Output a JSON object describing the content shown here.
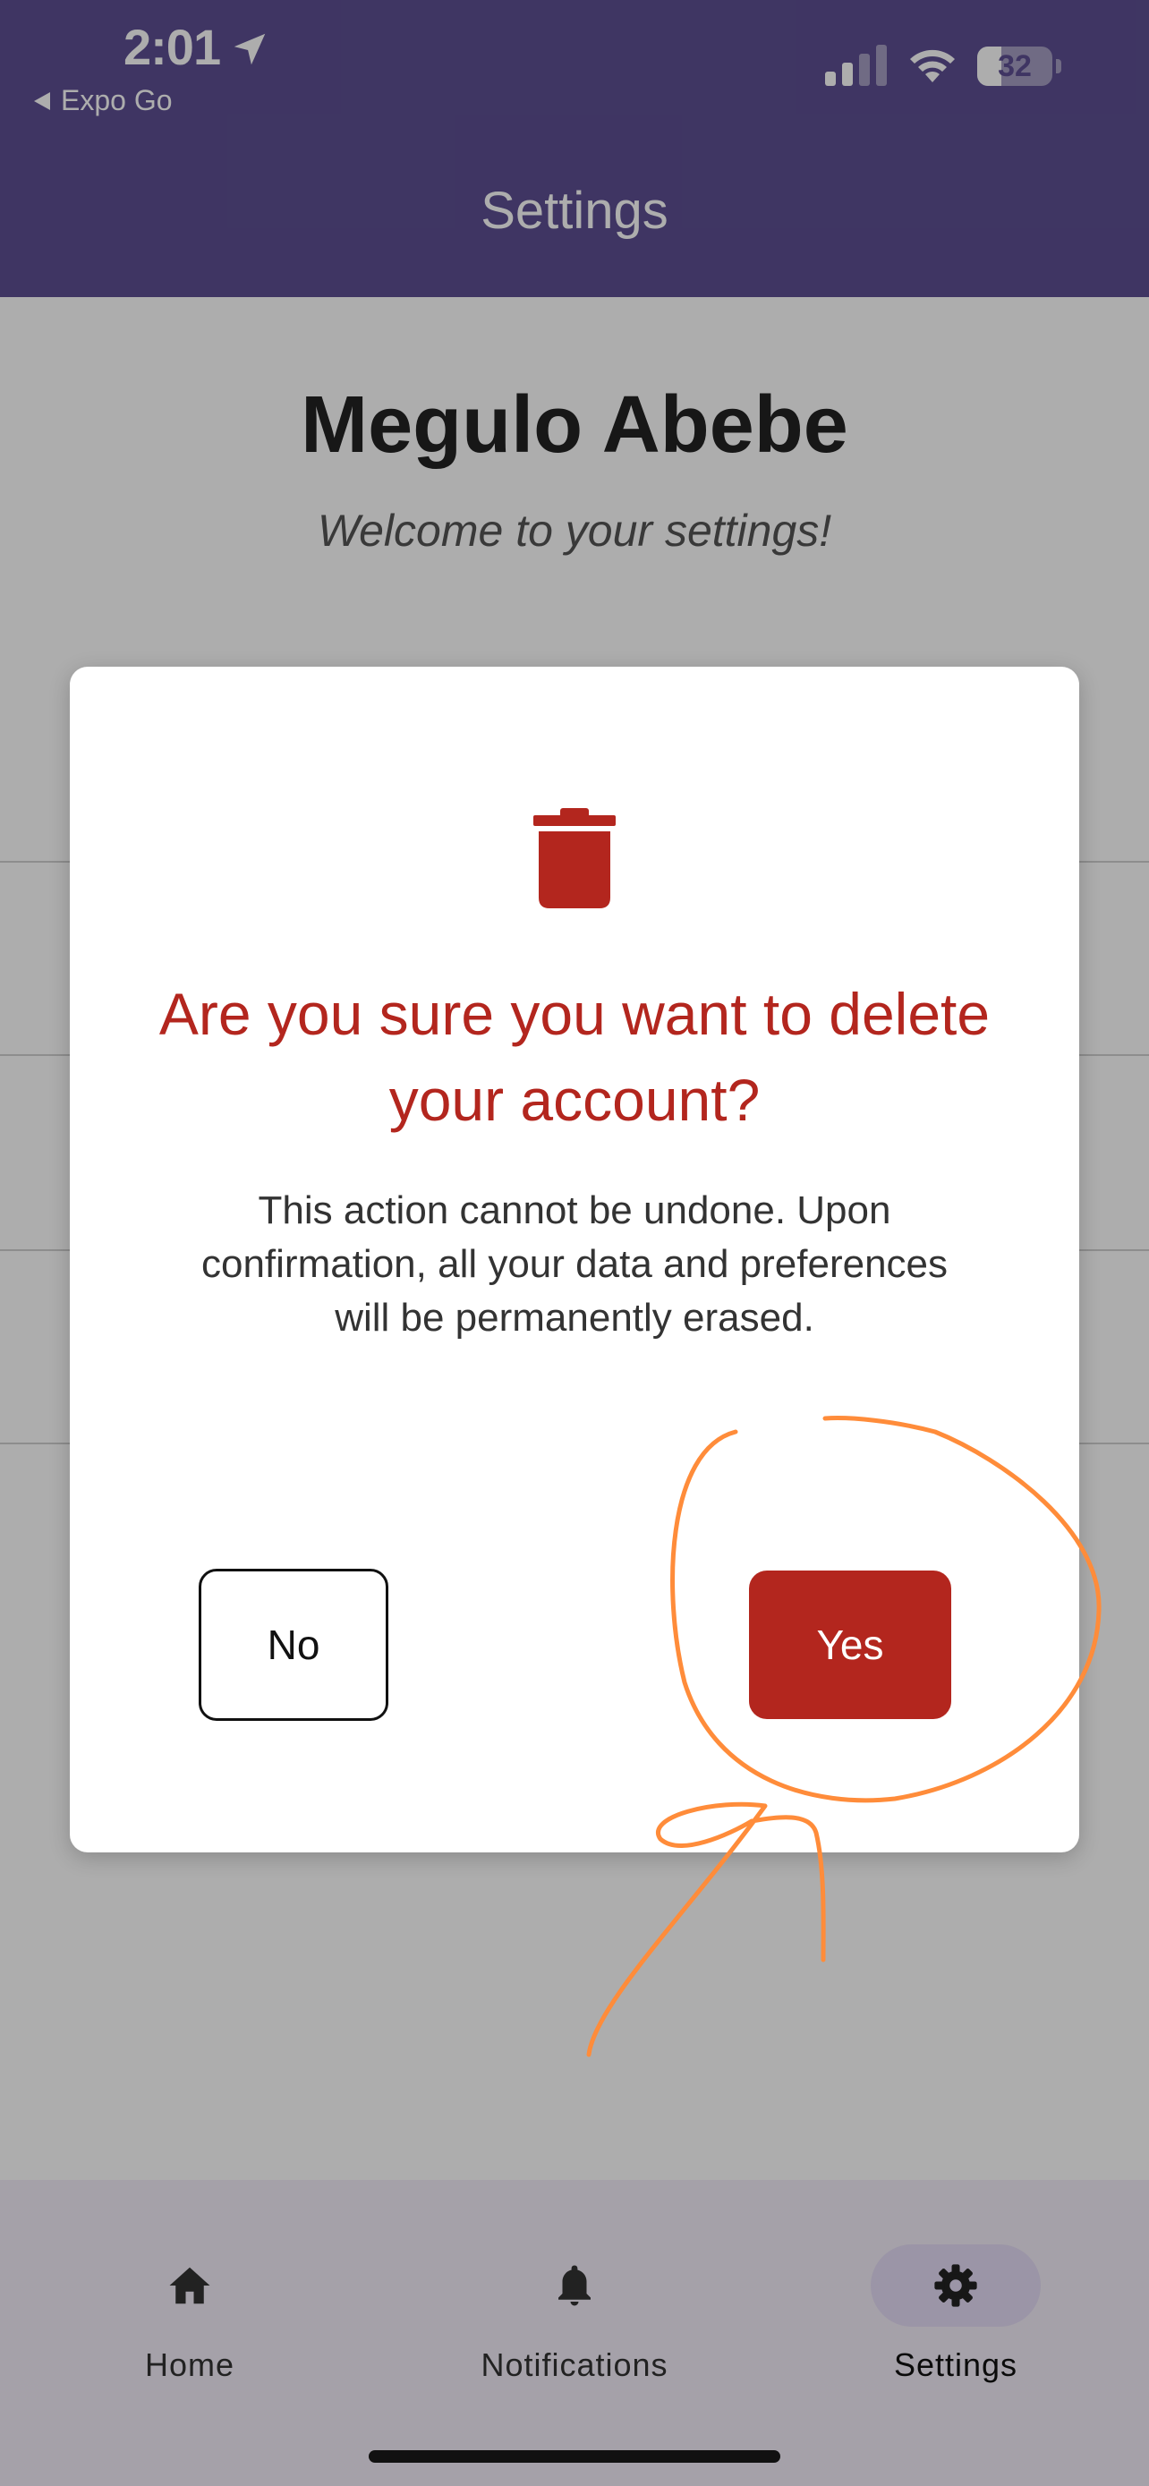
{
  "status_bar": {
    "time": "2:01",
    "back_app": "Expo Go",
    "battery_level": "32",
    "battery_fraction": 0.32
  },
  "header": {
    "title": "Settings"
  },
  "profile": {
    "name": "Megulo Abebe",
    "welcome": "Welcome to your settings!"
  },
  "modal": {
    "icon": "trash-icon",
    "title": "Are you sure you want to delete your account?",
    "message": "This action cannot be undone. Upon confirmation, all your data and preferences will be permanently erased.",
    "no_label": "No",
    "yes_label": "Yes"
  },
  "tabs": [
    {
      "label": "Home",
      "icon": "home-icon",
      "active": false
    },
    {
      "label": "Notifications",
      "icon": "bell-icon",
      "active": false
    },
    {
      "label": "Settings",
      "icon": "gear-icon",
      "active": true
    }
  ],
  "colors": {
    "header": "#5d4f92",
    "danger": "#b3261e",
    "annotation": "#ff8c3a"
  }
}
